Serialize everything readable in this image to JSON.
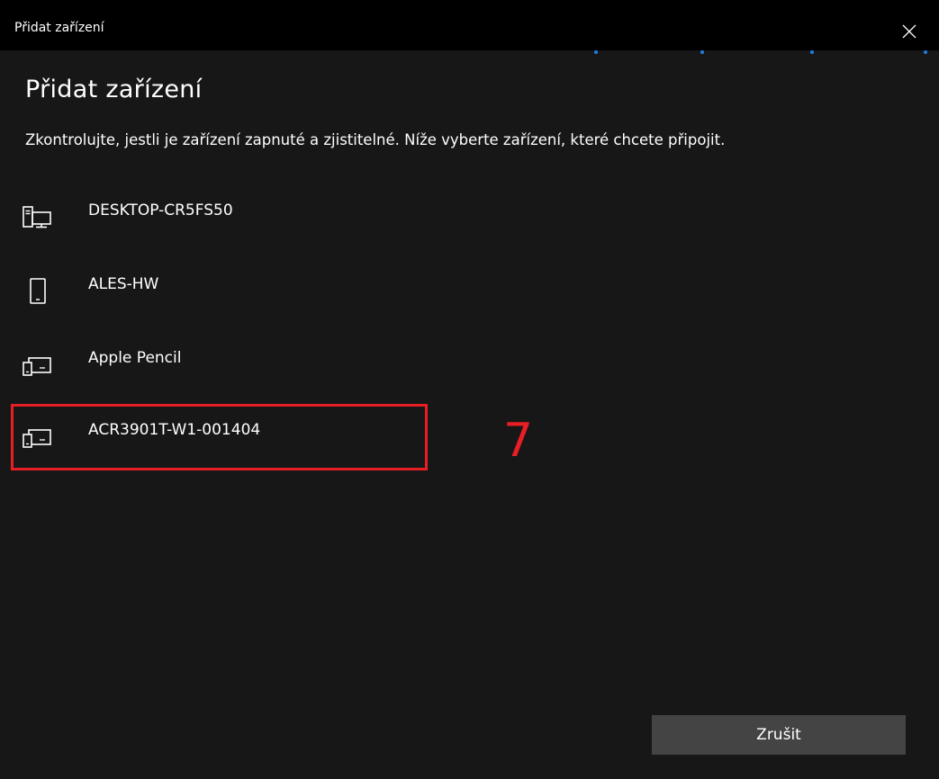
{
  "window": {
    "title": "Přidat zařízení",
    "close_icon": "close-icon"
  },
  "heading": "Přidat zařízení",
  "instruction": "Zkontrolujte, jestli je zařízení zapnuté a zjistitelné. Níže vyberte zařízení, které chcete připojit.",
  "devices": [
    {
      "label": "DESKTOP-CR5FS50",
      "icon": "desktop-computer-icon"
    },
    {
      "label": "ALES-HW",
      "icon": "phone-icon"
    },
    {
      "label": "Apple Pencil",
      "icon": "device-icon"
    },
    {
      "label": "ACR3901T-W1-001404",
      "icon": "device-icon"
    }
  ],
  "annotation": {
    "step_number": "7",
    "color": "#e81e25"
  },
  "buttons": {
    "cancel_label": "Zrušit"
  },
  "colors": {
    "background": "#171717",
    "titlebar": "#000000",
    "text": "#ffffff",
    "button": "#444444",
    "progress_dots": "#1e7fe0"
  }
}
